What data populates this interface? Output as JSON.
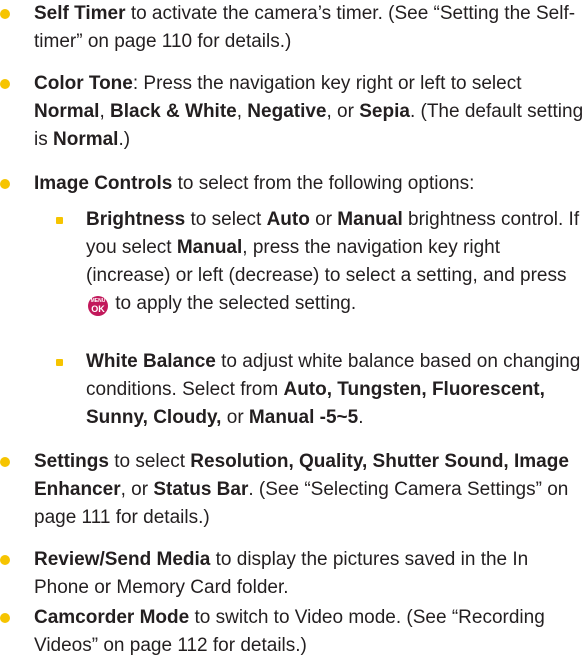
{
  "colors": {
    "bullet": "#f6c400",
    "text": "#231f20",
    "ok_key": "#c2185b"
  },
  "items": [
    {
      "term": "Self Timer",
      "text": "to activate the camera’s timer. (See “Setting the Self-timer” on page 110 for details.)"
    },
    {
      "term": "Color Tone",
      "t1": ": Press the navigation key right or left to select ",
      "v1": "Normal",
      "sep1": ", ",
      "v2": "Black & White",
      "sep2": ", ",
      "v3": "Negative",
      "sep3": ", or ",
      "v4": "Sepia",
      "t2": ". (The default setting is ",
      "v5": "Normal",
      "t3": ".)"
    },
    {
      "term": "Image Controls",
      "text": "to select from the following options:"
    },
    {
      "term": "Settings",
      "t1": " to select ",
      "v1": "Resolution, Quality, Shutter Sound, Image Enhancer",
      "t2": ", or ",
      "v2": "Status Bar",
      "t3": ". (See “Selecting Camera Settings” on page 111 for details.)"
    },
    {
      "term": "Review/Send Media",
      "text": "to display the pictures saved in the In Phone or Memory Card folder."
    },
    {
      "term": "Camcorder Mode",
      "text": "to switch to Video mode. (See “Recording Videos” on page 112 for details.)"
    }
  ],
  "subitems": [
    {
      "term": "Brightness",
      "t1": " to select ",
      "v1": "Auto",
      "t2": " or ",
      "v2": "Manual",
      "t3": " brightness control. If you select ",
      "v3": "Manual",
      "t4": ", press the navigation key right (increase) or left (decrease) to select a setting, and press ",
      "key_top": "MENU",
      "key_bottom": "OK",
      "t5": " to apply the selected setting."
    },
    {
      "term": "White Balance",
      "t1": " to adjust white balance based on changing conditions. Select from ",
      "v1": "Auto, Tungsten, Fluorescent, Sunny, Cloudy,",
      "t2": " or ",
      "v2": "Manual -5~5",
      "t3": "."
    }
  ]
}
